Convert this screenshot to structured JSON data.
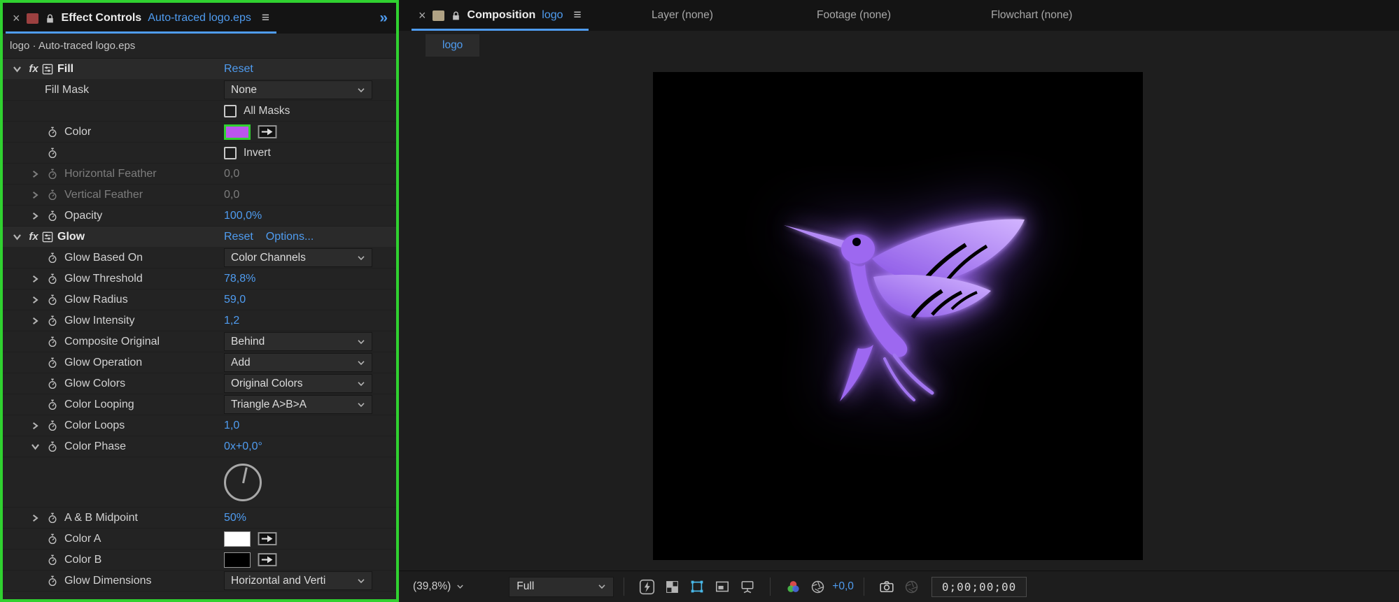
{
  "colors": {
    "accent_blue": "#4f9cf0",
    "selection_green": "#30d130",
    "fill_color_swatch": "#bb55ee",
    "color_a_swatch": "#ffffff",
    "color_b_swatch": "#000000",
    "bird_purple": "#9d67f0",
    "mask_icon_blue": "#49b8e8",
    "left_tab_square": "#9c4040",
    "right_tab_square": "#b0a284"
  },
  "effect_controls": {
    "close": "×",
    "title": "Effect Controls",
    "document": "Auto-traced logo.eps",
    "menu": "≡",
    "overflow": "»",
    "fx_badge": "fx",
    "breadcrumb": "logo · Auto-traced logo.eps",
    "fill": {
      "name": "Fill",
      "reset": "Reset",
      "fill_mask": {
        "label": "Fill Mask",
        "value": "None"
      },
      "all_masks": {
        "label": "All Masks"
      },
      "color": {
        "label": "Color"
      },
      "invert": {
        "label": "Invert"
      },
      "horizontal_feather": {
        "label": "Horizontal Feather",
        "value": "0,0"
      },
      "vertical_feather": {
        "label": "Vertical Feather",
        "value": "0,0"
      },
      "opacity": {
        "label": "Opacity",
        "value": "100,0%"
      }
    },
    "glow": {
      "name": "Glow",
      "reset": "Reset",
      "options": "Options...",
      "glow_based_on": {
        "label": "Glow Based On",
        "value": "Color Channels"
      },
      "glow_threshold": {
        "label": "Glow Threshold",
        "value": "78,8%"
      },
      "glow_radius": {
        "label": "Glow Radius",
        "value": "59,0"
      },
      "glow_intensity": {
        "label": "Glow Intensity",
        "value": "1,2"
      },
      "composite_original": {
        "label": "Composite Original",
        "value": "Behind"
      },
      "glow_operation": {
        "label": "Glow Operation",
        "value": "Add"
      },
      "glow_colors": {
        "label": "Glow Colors",
        "value": "Original Colors"
      },
      "color_looping": {
        "label": "Color Looping",
        "value": "Triangle A>B>A"
      },
      "color_loops": {
        "label": "Color Loops",
        "value": "1,0"
      },
      "color_phase": {
        "label": "Color Phase",
        "value": "0x+0,0°"
      },
      "ab_midpoint": {
        "label": "A & B Midpoint",
        "value": "50%"
      },
      "color_a": {
        "label": "Color A"
      },
      "color_b": {
        "label": "Color B"
      },
      "glow_dimensions": {
        "label": "Glow Dimensions",
        "value": "Horizontal and Verti"
      }
    }
  },
  "composition": {
    "close": "×",
    "title": "Composition",
    "document": "logo",
    "menu": "≡",
    "other_tabs": [
      "Layer (none)",
      "Footage (none)",
      "Flowchart (none)"
    ],
    "viewer_tab": "logo",
    "toolbar": {
      "zoom": "(39,8%)",
      "resolution": "Full",
      "exposure": "+0,0",
      "timecode": "0;00;00;00"
    }
  }
}
